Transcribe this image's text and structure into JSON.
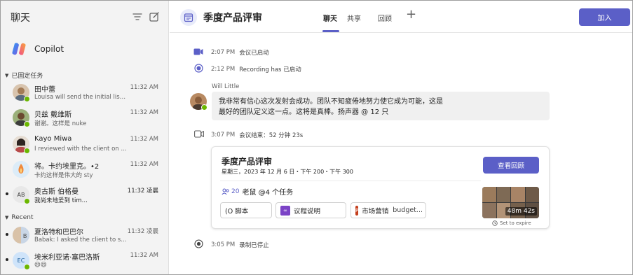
{
  "sidebar": {
    "title": "聊天",
    "copilot_label": "Copilot",
    "pinned_section": "已固定任务",
    "recent_section": "Recent",
    "chats": [
      {
        "name": "田中蕾",
        "preview": "Louisa will send the initial list of...",
        "time": "11:32 AM",
        "initials": "",
        "avatar_color": "#c8a27a",
        "bold": false
      },
      {
        "name": "贝兹 戴维斯",
        "preview": "谢谢。这样是 nuke",
        "time": "11:32 AM",
        "initials": "",
        "avatar_color": "#7a5a3a",
        "bold": false
      },
      {
        "name": "Kayo Miwa",
        "preview": "I reviewed with the client on Th...",
        "time": "11:32 AM",
        "initials": "",
        "avatar_color": "#b08060",
        "bold": false
      },
      {
        "name": "将。卡约埃里克。•2",
        "preview": "卡约这样是伟大的 sty",
        "time": "11:32 AM",
        "initials": "",
        "avatar_color": "#f2a65a",
        "bold": false
      },
      {
        "name": "奥古斯 伯格曼",
        "preview": "我尚未地爱到 tim...",
        "time": "11:32 凌晨",
        "initials": "AB",
        "avatar_color": "#e8e8e8",
        "bold": true
      },
      {
        "name": "夏洛特和巴巴尔",
        "preview": "Babak: I asked the client to send...",
        "time": "11:32 凌晨",
        "initials": "B",
        "avatar_color": "#d9c2a8",
        "bold": false
      },
      {
        "name": "埃米利亚诺·塞巴洛斯",
        "preview": "😄😄",
        "time": "11:32 AM",
        "initials": "EC",
        "avatar_color": "#cfe4fa",
        "bold": false
      }
    ]
  },
  "header": {
    "title": "季度产品评审",
    "tabs": [
      "聊天",
      "共享",
      "回顾"
    ],
    "join_label": "加入"
  },
  "events": {
    "e1_time": "2:07 PM",
    "e1_text": "会议已启动",
    "e2_time": "2:12 PM",
    "e2_text": "Recording has 已启动",
    "sender": "Will Little",
    "message_line1": "我非常有信心这次发射会成功。团队不知疲倦地努力使它成为可能，这是",
    "message_line2": "最好的团队定义这一点。这将是真棒。扬声器 @ 12 只",
    "e3_time": "3:07 PM",
    "e3_text": "会议结束：52 分钟 23s",
    "e4_time": "3:05 PM",
    "e4_text": "录制已停止"
  },
  "card": {
    "title": "季度产品评审",
    "subtitle": "星期三，2023 年 12 月 6 日・下午 200・下午 300",
    "recap_button": "查看回顾",
    "count": "20",
    "meta_text": "老鼠 @4 个任务",
    "files": [
      {
        "label": "(O 脚本",
        "icon": "loop-icon",
        "color": "#ffffff"
      },
      {
        "label": "议程说明",
        "icon": "loop-icon",
        "color": "#7b43c6"
      },
      {
        "label": "市场营销",
        "suffix": "budget...",
        "icon": "powerpoint-icon",
        "color": "#c43e1c"
      }
    ],
    "duration": "48m 42s",
    "expire_text": "Set to expire"
  },
  "colors": {
    "accent": "#5b5fc7",
    "presence_available": "#6bb700"
  }
}
